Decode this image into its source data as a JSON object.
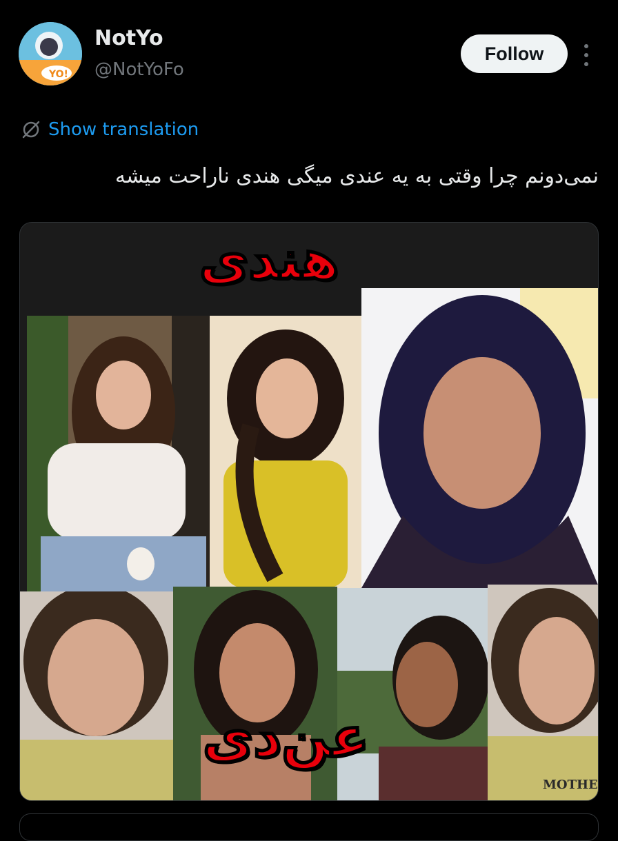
{
  "post": {
    "author": {
      "display_name": "NotYo",
      "handle": "@NotYoFo",
      "avatar_label": "YO!"
    },
    "follow_label": "Follow",
    "show_translation_label": "Show translation",
    "text": "نمی‌دونم چرا وقتی به یه عندی میگی هندی ناراحت میشه",
    "media": {
      "top_label": "هندی",
      "bottom_label": "عن‌دی",
      "shirt_text": "MOTHER"
    }
  },
  "colors": {
    "background": "#000000",
    "link": "#1d9bf0",
    "follow_bg": "#eff3f4",
    "meme_red": "#e8000b"
  },
  "icons": {
    "translate": "no-translate-icon",
    "more": "more-dots-icon"
  }
}
